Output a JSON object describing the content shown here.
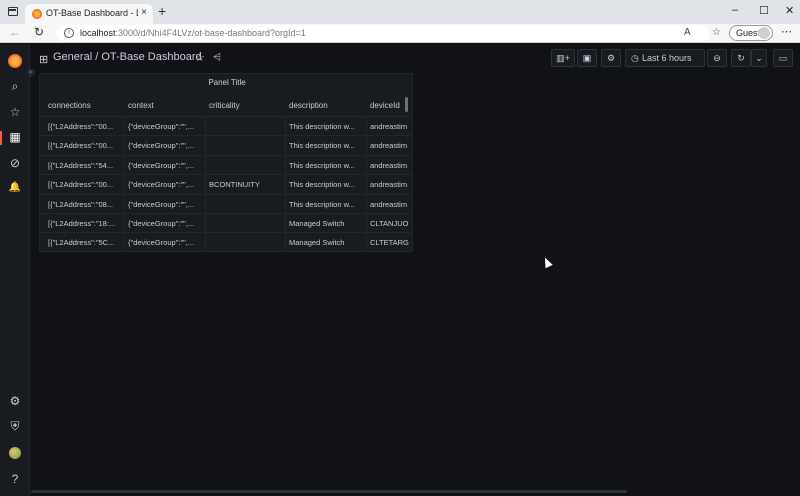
{
  "browser": {
    "tab_title": "OT-Base Dashboard - Dashboards",
    "tab_close": "×",
    "new_tab": "+",
    "url_host": "localhost",
    "url_path": ":3000/d/Nhi4F4LVz/ot-base-dashboard?orgId=1",
    "profile_label": "Guest",
    "window_controls": [
      "–",
      "☐",
      "✕"
    ]
  },
  "dashboard": {
    "folder": "General",
    "separator": "/",
    "title": "OT-Base Dashboard",
    "time_range": "Last 6 hours"
  },
  "panel": {
    "title": "Panel Title",
    "columns": [
      "connections",
      "context",
      "criticality",
      "description",
      "deviceId"
    ],
    "rows": [
      [
        "[{\"L2Address\":\"00...",
        "{\"deviceGroup\":\"\",...",
        "",
        "This description w...",
        "andreastim"
      ],
      [
        "[{\"L2Address\":\"00...",
        "{\"deviceGroup\":\"\",...",
        "",
        "This description w...",
        "andreastim"
      ],
      [
        "[{\"L2Address\":\"54...",
        "{\"deviceGroup\":\"\",...",
        "",
        "This description w...",
        "andreastim"
      ],
      [
        "[{\"L2Address\":\"00...",
        "{\"deviceGroup\":\"\",...",
        "BCONTINUITY",
        "This description w...",
        "andreastim"
      ],
      [
        "[{\"L2Address\":\"08...",
        "{\"deviceGroup\":\"\",...",
        "",
        "This description w...",
        "andreastim"
      ],
      [
        "[{\"L2Address\":\"18:...",
        "{\"deviceGroup\":\"\",...",
        "",
        "Managed Switch",
        "CLTANJUO"
      ],
      [
        "[{\"L2Address\":\"5C...",
        "{\"deviceGroup\":\"\",...",
        "",
        "Managed Switch",
        "CLTETARG"
      ]
    ]
  },
  "icons": {
    "search": "⌕",
    "star": "☆",
    "dashboards": "▦",
    "explore": "⊘",
    "alerting": "🔔",
    "config": "⚙",
    "shield": "⛨",
    "help": "?",
    "share": "⋖",
    "grid": "⊞",
    "back": "←",
    "reload": "↻",
    "add_panel": "📊",
    "save": "💾",
    "settings": "⚙",
    "clock": "◷",
    "zoom_out": "⊖",
    "refresh": "↻",
    "chevron_down": "⌄",
    "tv": "▭"
  },
  "colors": {
    "background": "#111217",
    "panel_bg": "#181b1f",
    "text": "#ccccdc",
    "accent": "#f55f3e"
  }
}
